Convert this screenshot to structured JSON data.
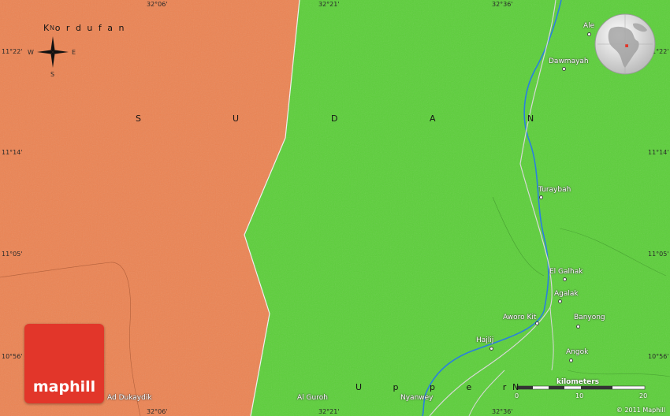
{
  "region_label": "K o r d u f a n",
  "country_letters": [
    "S",
    "U",
    "D",
    "A",
    "N"
  ],
  "upper_label": "U p p e r",
  "upper_fragment": "N",
  "compass": {
    "n": "N",
    "s": "S",
    "e": "E",
    "w": "W"
  },
  "coords": {
    "top": [
      "32°06'",
      "32°21'",
      "32°36'"
    ],
    "bottom": [
      "32°06'",
      "32°21'",
      "32°36'"
    ],
    "left": [
      "11°22'",
      "11°14'",
      "11°05'",
      "10°56'"
    ],
    "right": [
      "11°22'",
      "11°14'",
      "11°05'",
      "10°56'"
    ]
  },
  "places": {
    "elei": "Ale",
    "dawmayah": "Dawmayah",
    "turaybah": "Turaybah",
    "el_galhak": "El Galhak",
    "agalak": "Agalak",
    "aworo_kit": "Aworo Kit",
    "banyong": "Banyong",
    "hajlij": "Hajlij",
    "angok": "Angok",
    "al_guroh": "Al Guroh",
    "nyanwey": "Nyanwey",
    "ad_dukaydik": "Ad Dukaydik"
  },
  "scale": {
    "title": "kilometers",
    "ticks": [
      "0",
      "10",
      "20"
    ]
  },
  "logo_text": "maphill",
  "copyright": "© 2011 Maphill",
  "colors": {
    "west_region": "#ec8453",
    "east_region": "#5ccf3a",
    "river": "#2a7fe0",
    "logo": "#e2362a"
  }
}
